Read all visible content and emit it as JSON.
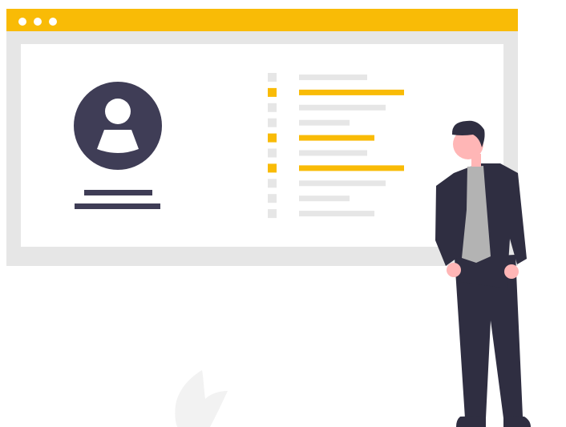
{
  "colors": {
    "accent": "#f9bb06",
    "dark": "#3f3d56",
    "suit": "#2f2e41",
    "frame": "#e6e6e6",
    "panel": "#ffffff",
    "placeholder_line": "#e6e6e6",
    "skin": "#ffb6b6",
    "shirt": "#b3b3b3",
    "hair": "#2f2e41",
    "plant": "#f2f2f2"
  },
  "window": {
    "controls": [
      {
        "name": "window-dot-1-icon"
      },
      {
        "name": "window-dot-2-icon"
      },
      {
        "name": "window-dot-3-icon"
      }
    ]
  },
  "profile": {
    "avatar_icon": "user-avatar-icon"
  },
  "list": {
    "items": [
      {
        "highlighted": false
      },
      {
        "highlighted": true
      },
      {
        "highlighted": false
      },
      {
        "highlighted": false
      },
      {
        "highlighted": true
      },
      {
        "highlighted": false
      },
      {
        "highlighted": true
      },
      {
        "highlighted": false
      },
      {
        "highlighted": false
      },
      {
        "highlighted": false
      }
    ]
  },
  "decor": {
    "person": "standing-man-illustration",
    "plant": "leaf-plant-illustration"
  }
}
